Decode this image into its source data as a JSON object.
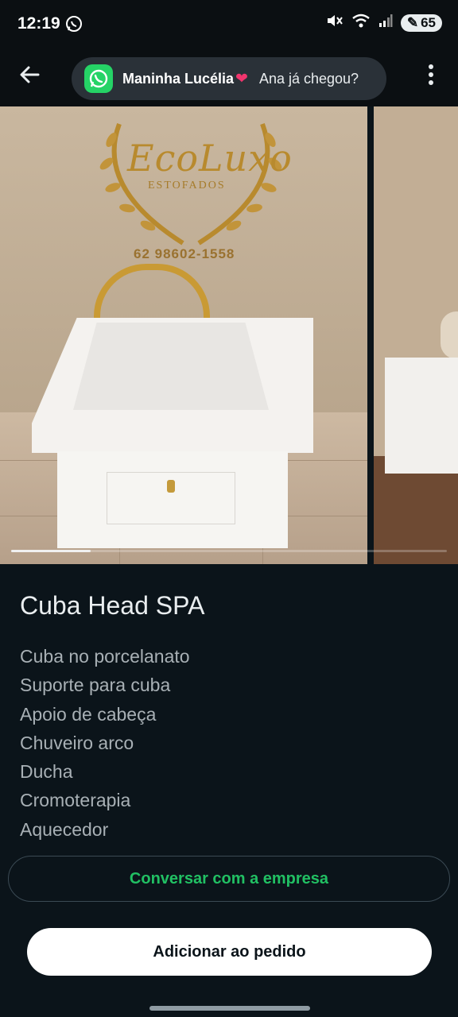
{
  "status_bar": {
    "time": "12:19",
    "battery": "65",
    "icons": [
      "whatsapp-icon",
      "mute-icon",
      "wifi-icon",
      "signal-icon",
      "battery-icon"
    ]
  },
  "app_bar": {
    "back_icon": "arrow-left-icon",
    "menu_icon": "more-vertical-icon"
  },
  "notification": {
    "app_icon": "whatsapp-icon",
    "sender": "Maninha Lucélia",
    "emoji": "❤",
    "message": "Ana já chegou?"
  },
  "carousel": {
    "image_logo_text": "EcoLuxo",
    "image_logo_sub": "ESTOFADOS",
    "image_phone": "62 98602-1558",
    "position": 1
  },
  "product": {
    "title": "Cuba Head SPA",
    "features": [
      "Cuba no porcelanato",
      "Suporte para cuba",
      "Apoio de cabeça",
      "Chuveiro arco",
      "Ducha",
      "Cromoterapia",
      "Aquecedor"
    ]
  },
  "actions": {
    "chat_label": "Conversar com a empresa",
    "add_label": "Adicionar ao pedido"
  },
  "colors": {
    "background": "#0b141a",
    "accent": "#21c063",
    "whatsapp": "#25d366"
  }
}
